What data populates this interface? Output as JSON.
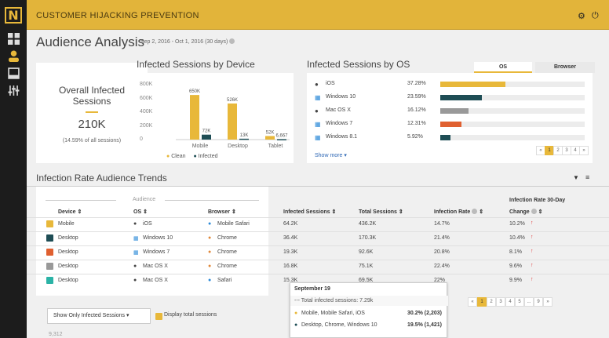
{
  "app": {
    "title": "CUSTOMER HIJACKING PREVENTION",
    "logo": "N"
  },
  "page": {
    "title": "Audience Analysis",
    "date_range": "Sep 2, 2016 - Oct 1, 2016 (30 days)"
  },
  "overall": {
    "label": "Overall Infected Sessions",
    "value": "210K",
    "sub": "(14.59% of all sessions)"
  },
  "device_chart": {
    "title": "Infected Sessions by Device",
    "legend": {
      "clean": "Clean",
      "infected": "Infected"
    },
    "chart_data": {
      "type": "bar",
      "categories": [
        "Mobile",
        "Desktop",
        "Tablet"
      ],
      "series": [
        {
          "name": "Clean",
          "values": [
            650000,
            526000,
            52000
          ]
        },
        {
          "name": "Infected",
          "values": [
            72000,
            13000,
            6667
          ]
        }
      ],
      "data_labels": [
        "650K",
        "72K",
        "526K",
        "13K",
        "52K",
        "6,667"
      ],
      "ylim": [
        0,
        800000
      ],
      "yticks": [
        "800K",
        "600K",
        "400K",
        "200K",
        "0"
      ]
    }
  },
  "os_chart": {
    "title": "Infected Sessions by OS",
    "tabs": [
      "OS",
      "Browser"
    ],
    "show_more": "Show more",
    "rows": [
      {
        "name": "iOS",
        "pct": "37.28%",
        "value": 37.28,
        "color": "#e8b83a"
      },
      {
        "name": "Windows 10",
        "pct": "23.59%",
        "value": 23.59,
        "color": "#1e4d55"
      },
      {
        "name": "Mac OS X",
        "pct": "16.12%",
        "value": 16.12,
        "color": "#999999"
      },
      {
        "name": "Windows 7",
        "pct": "12.31%",
        "value": 12.31,
        "color": "#e06030"
      },
      {
        "name": "Windows 8.1",
        "pct": "5.92%",
        "value": 5.92,
        "color": "#1e4d55"
      }
    ],
    "pagination": [
      "«",
      "1",
      "2",
      "3",
      "4",
      "»"
    ]
  },
  "trends": {
    "title": "Infection Rate Audience Trends",
    "audience_label": "Audience",
    "headers": {
      "device": "Device",
      "os": "OS",
      "browser": "Browser",
      "infected": "Infected Sessions",
      "total": "Total Sessions",
      "rate": "Infection Rate",
      "change_1": "Infection Rate 30-Day",
      "change_2": "Change"
    },
    "rows": [
      {
        "device": "Mobile",
        "os": "iOS",
        "browser": "Mobile Safari",
        "infected": "64.2K",
        "total": "436.2K",
        "rate": "14.7%",
        "change": "10.2%"
      },
      {
        "device": "Desktop",
        "os": "Windows 10",
        "browser": "Chrome",
        "infected": "36.4K",
        "total": "170.3K",
        "rate": "21.4%",
        "change": "10.4%"
      },
      {
        "device": "Desktop",
        "os": "Windows 7",
        "browser": "Chrome",
        "infected": "19.3K",
        "total": "92.6K",
        "rate": "20.8%",
        "change": "8.1%"
      },
      {
        "device": "Desktop",
        "os": "Mac OS X",
        "browser": "Chrome",
        "infected": "16.8K",
        "total": "75.1K",
        "rate": "22.4%",
        "change": "9.6%"
      },
      {
        "device": "Desktop",
        "os": "Mac OS X",
        "browser": "Safari",
        "infected": "15.3K",
        "total": "69.5K",
        "rate": "22%",
        "change": "9.9%"
      }
    ],
    "pagination": [
      "«",
      "1",
      "2",
      "3",
      "4",
      "5",
      "...",
      "9",
      "»"
    ],
    "filter_select": "Show Only Infected Sessions",
    "display_total": "Display total sessions",
    "bottom_axis": "9,312"
  },
  "tooltip": {
    "date": "September 19",
    "total": "--- Total infected sessions: 7.29k",
    "items": [
      {
        "label": "Mobile, Mobile Safari, iOS",
        "value": "30.2% (2,203)"
      },
      {
        "label": "Desktop, Chrome, Windows 10",
        "value": "19.5% (1,421)"
      }
    ]
  }
}
